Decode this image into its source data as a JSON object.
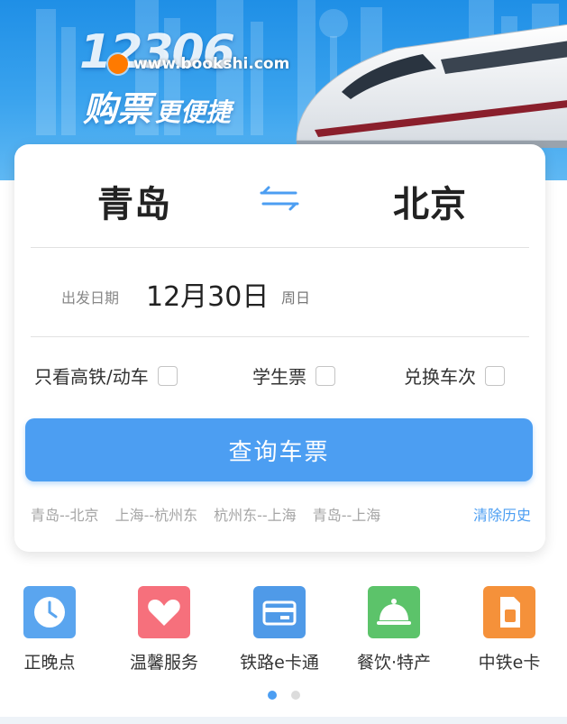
{
  "banner": {
    "title": "12306",
    "subtitle_main": "购票",
    "subtitle_small": "更便捷",
    "watermark": "www.bookshi.com"
  },
  "route": {
    "from": "青岛",
    "to": "北京"
  },
  "date": {
    "label": "出发日期",
    "value": "12月30日",
    "weekday": "周日"
  },
  "options": [
    {
      "label": "只看高铁/动车",
      "checked": false
    },
    {
      "label": "学生票",
      "checked": false
    },
    {
      "label": "兑换车次",
      "checked": false
    }
  ],
  "search_button": "查询车票",
  "history": {
    "items": [
      "青岛--北京",
      "上海--杭州东",
      "杭州东--上海",
      "青岛--上海"
    ],
    "clear_label": "清除历史"
  },
  "services": [
    {
      "label": "正晚点",
      "icon": "clock-icon",
      "color": "#5aa5ef"
    },
    {
      "label": "温馨服务",
      "icon": "heart-icon",
      "color": "#f6707c"
    },
    {
      "label": "铁路e卡通",
      "icon": "card-icon",
      "color": "#4f9ae8"
    },
    {
      "label": "餐饮·特产",
      "icon": "food-bell-icon",
      "color": "#5cc36a"
    },
    {
      "label": "中铁e卡",
      "icon": "sim-card-icon",
      "color": "#f5913a"
    }
  ],
  "pager": {
    "pages": 2,
    "current": 1
  },
  "colors": {
    "primary": "#4c9ef2",
    "banner": "#1f8fe6"
  }
}
